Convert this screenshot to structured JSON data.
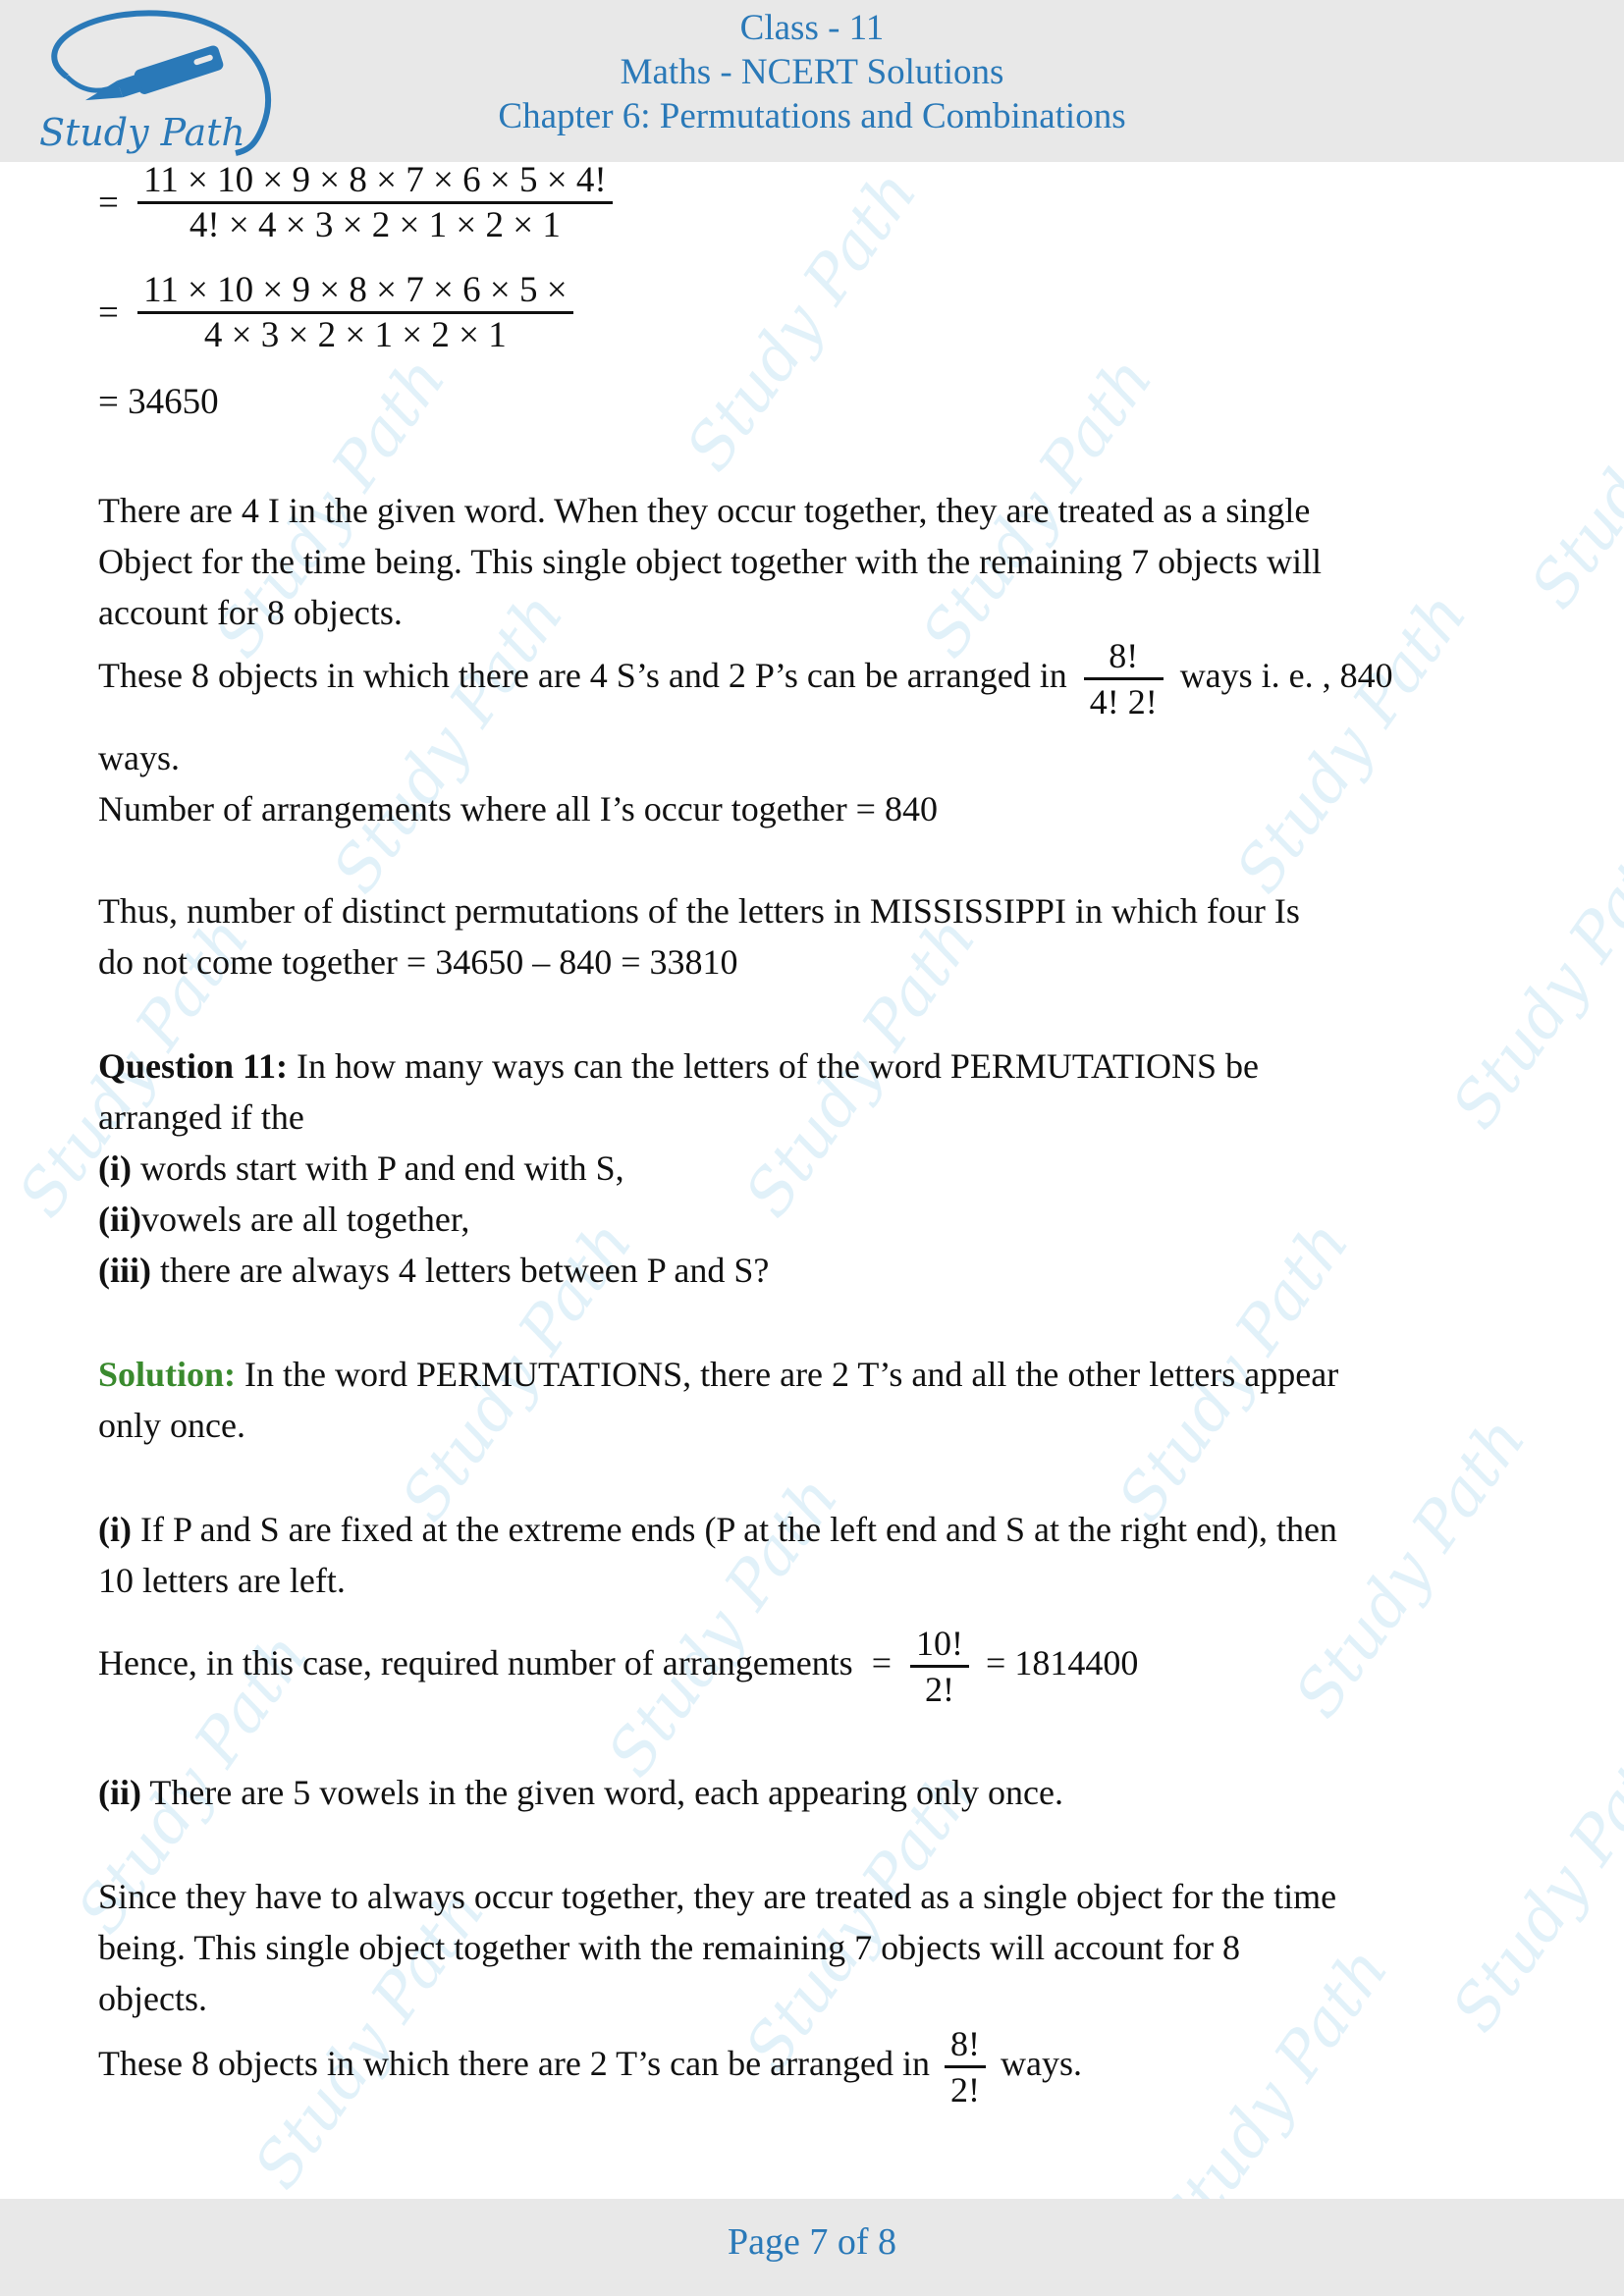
{
  "header": {
    "logo_text": "Study Path",
    "line1": "Class - 11",
    "line2": "Maths - NCERT Solutions",
    "line3": "Chapter 6: Permutations and Combinations"
  },
  "watermark_text": "Study Path",
  "math_top": {
    "eq1": {
      "prefix": "=",
      "num": "11 × 10 × 9 × 8 × 7 × 6 × 5 × 4!",
      "den": "4! × 4 × 3 × 2 × 1 × 2 × 1"
    },
    "eq2": {
      "prefix": "=",
      "num": "11 × 10 × 9 × 8 × 7 × 6 × 5 ×",
      "den": "4 × 3 × 2 × 1 × 2 × 1"
    },
    "eq3": "= 34650"
  },
  "para1": [
    "There are 4 I in the given word. When they occur together, they are treated as a single",
    "Object for the time being. This single object together with the remaining 7 objects will",
    "account for 8 objects."
  ],
  "para2": {
    "before": "These 8 objects in which there are 4 S’s and 2 P’s can be arranged in",
    "num": "8!",
    "den": "4! 2!",
    "after": "ways i. e. , 840",
    "line2": "ways.",
    "line3": "Number of arrangements where all I’s occur together = 840"
  },
  "para3": [
    "Thus, number of distinct permutations of the letters in MISSISSIPPI in which four Is",
    "do not come together = 34650 – 840 = 33810"
  ],
  "question": {
    "label": "Question 11:",
    "text": " In how many ways can the letters of the word PERMUTATIONS be",
    "line2": "arranged if the",
    "parts": [
      {
        "label": "(i)",
        "text": " words start with P and end with S,"
      },
      {
        "label": "(ii)",
        "text": "vowels are all together,"
      },
      {
        "label": "(iii)",
        "text": " there are always 4 letters between P and S?"
      }
    ]
  },
  "solution": {
    "label": "Solution:",
    "text": " In the word PERMUTATIONS, there are 2 T’s and all the other letters appear",
    "line2": "only once.",
    "part1": {
      "label": "(i)",
      "text": " If P and S are fixed at the extreme ends (P at the left end and S at the right end), then",
      "line2": "10 letters are left.",
      "result_before": "Hence, in this case, required number of arrangements",
      "result_eq": "=",
      "num": "10!",
      "den": "2!",
      "result_after": "= 1814400"
    },
    "part2": {
      "label": "(ii)",
      "text": " There are 5 vowels in the given word, each appearing only once.",
      "para": [
        "Since they have to always occur together, they are treated as a single object for the time",
        "being. This single object together with the remaining 7 objects will account for 8",
        "objects."
      ],
      "last_before": "These 8 objects in which there are 2 T’s can be arranged in",
      "num": "8!",
      "den": "2!",
      "last_after": "ways."
    }
  },
  "footer": {
    "page_label": "Page 7 of 8"
  },
  "colors": {
    "header_bg": "#e8e8e8",
    "header_text": "#2a79b8",
    "solution_label": "#3a8a2e",
    "watermark": "#c9e6f5"
  }
}
